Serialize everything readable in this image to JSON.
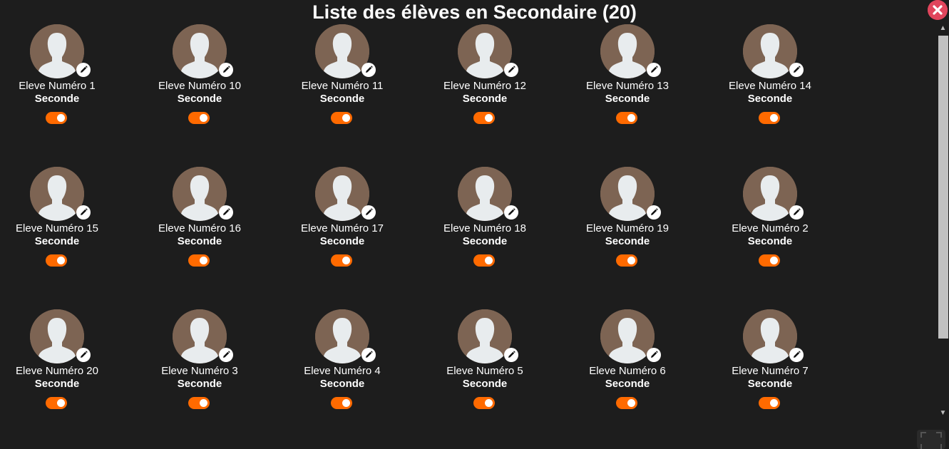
{
  "title": "Liste des élèves en Secondaire (20)",
  "icons": {
    "close": "close-icon",
    "edit": "pencil-icon",
    "avatar": "user-silhouette-icon",
    "fullscreen": "fullscreen-icon"
  },
  "colors": {
    "background": "#1d1d1d",
    "avatar": "#7d6453",
    "toggle": "#ff6a00",
    "close": "#e0455c"
  },
  "students": [
    {
      "name": "Eleve Numéro 1",
      "level": "Seconde",
      "active": true
    },
    {
      "name": "Eleve Numéro 10",
      "level": "Seconde",
      "active": true
    },
    {
      "name": "Eleve Numéro 11",
      "level": "Seconde",
      "active": true
    },
    {
      "name": "Eleve Numéro 12",
      "level": "Seconde",
      "active": true
    },
    {
      "name": "Eleve Numéro 13",
      "level": "Seconde",
      "active": true
    },
    {
      "name": "Eleve Numéro 14",
      "level": "Seconde",
      "active": true
    },
    {
      "name": "Eleve Numéro 15",
      "level": "Seconde",
      "active": true
    },
    {
      "name": "Eleve Numéro 16",
      "level": "Seconde",
      "active": true
    },
    {
      "name": "Eleve Numéro 17",
      "level": "Seconde",
      "active": true
    },
    {
      "name": "Eleve Numéro 18",
      "level": "Seconde",
      "active": true
    },
    {
      "name": "Eleve Numéro 19",
      "level": "Seconde",
      "active": true
    },
    {
      "name": "Eleve Numéro 2",
      "level": "Seconde",
      "active": true
    },
    {
      "name": "Eleve Numéro 20",
      "level": "Seconde",
      "active": true
    },
    {
      "name": "Eleve Numéro 3",
      "level": "Seconde",
      "active": true
    },
    {
      "name": "Eleve Numéro 4",
      "level": "Seconde",
      "active": true
    },
    {
      "name": "Eleve Numéro 5",
      "level": "Seconde",
      "active": true
    },
    {
      "name": "Eleve Numéro 6",
      "level": "Seconde",
      "active": true
    },
    {
      "name": "Eleve Numéro 7",
      "level": "Seconde",
      "active": true
    }
  ]
}
